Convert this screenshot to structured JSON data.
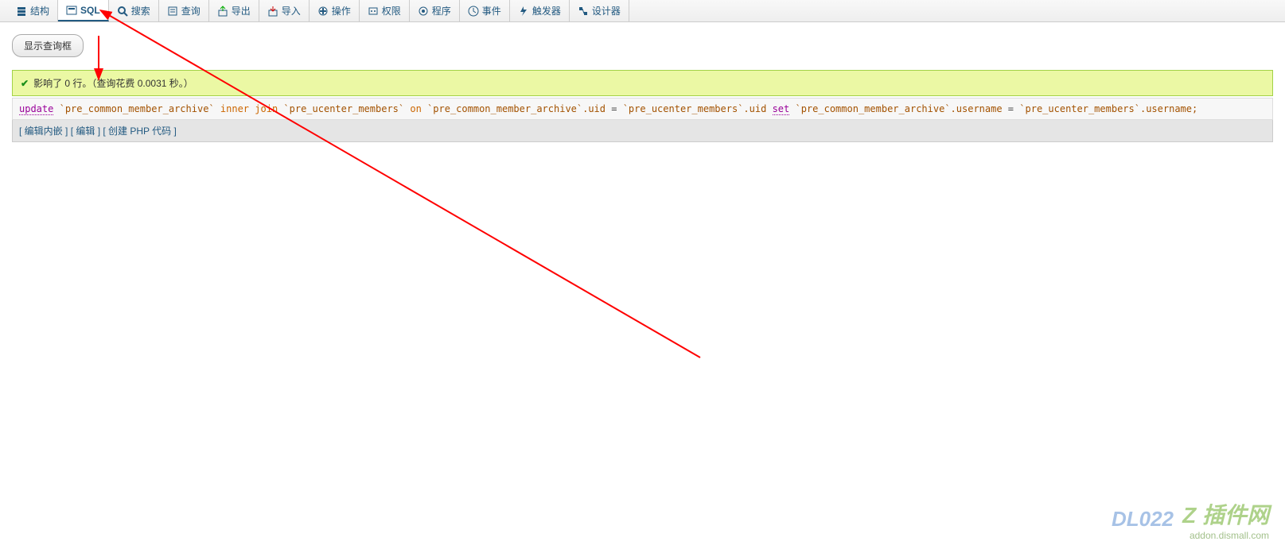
{
  "tabs": [
    {
      "label": "结构",
      "icon": "structure"
    },
    {
      "label": "SQL",
      "icon": "sql",
      "active": true
    },
    {
      "label": "搜索",
      "icon": "search"
    },
    {
      "label": "查询",
      "icon": "query"
    },
    {
      "label": "导出",
      "icon": "export"
    },
    {
      "label": "导入",
      "icon": "import"
    },
    {
      "label": "操作",
      "icon": "operations"
    },
    {
      "label": "权限",
      "icon": "privileges"
    },
    {
      "label": "程序",
      "icon": "routines"
    },
    {
      "label": "事件",
      "icon": "events"
    },
    {
      "label": "触发器",
      "icon": "triggers"
    },
    {
      "label": "设计器",
      "icon": "designer"
    }
  ],
  "button_show_query": "显示查询框",
  "success_msg": "影响了 0 行。（查询花费 0.0031 秒。）",
  "sql_parts": {
    "kw_update": "update",
    "t1": "`pre_common_member_archive`",
    "kw_inner": "inner",
    "kw_join": "join",
    "t2": "`pre_ucenter_members`",
    "kw_on": "on",
    "c1": "`pre_common_member_archive`.uid",
    "eq": " = ",
    "c2": "`pre_ucenter_members`.uid",
    "kw_set": "set",
    "c3": "`pre_common_member_archive`.username",
    "eq2": " = ",
    "c4": "`pre_ucenter_members`.username;",
    "sp": " "
  },
  "links": {
    "edit_inline": "编辑内嵌",
    "edit": "编辑",
    "create_php": "创建 PHP 代码"
  },
  "watermark1": "DL022",
  "watermark2_main": "Z 插件网",
  "watermark2_sub": "addon.dismall.com"
}
